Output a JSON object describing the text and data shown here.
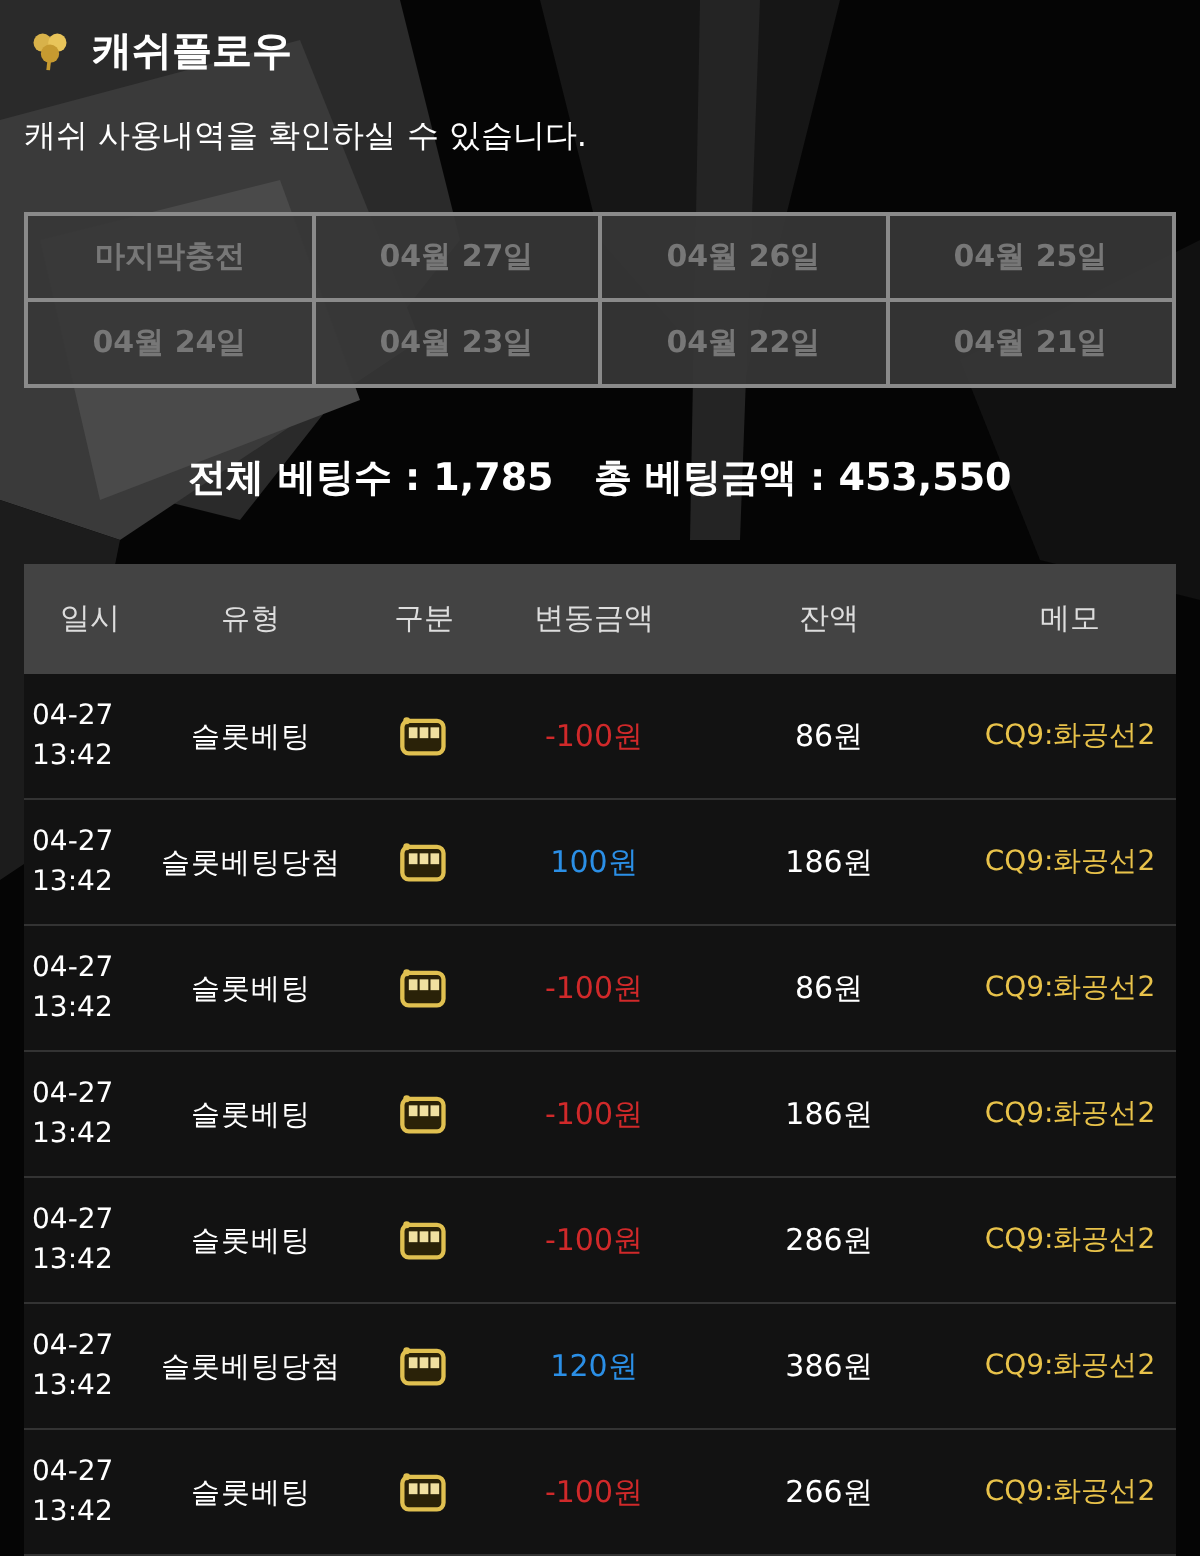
{
  "header": {
    "title": "캐쉬플로우",
    "subtitle": "캐쉬 사용내역을 확인하실 수 있습니다."
  },
  "date_buttons": [
    "마지막충전",
    "04월 27일",
    "04월 26일",
    "04월 25일",
    "04월 24일",
    "04월 23일",
    "04월 22일",
    "04월 21일"
  ],
  "totals": {
    "bet_count_label": "전체 베팅수 : 1,785",
    "bet_amount_label": "총 베팅금액 : 453,550"
  },
  "table": {
    "columns": [
      "일시",
      "유형",
      "구분",
      "변동금액",
      "잔액",
      "메모"
    ],
    "rows": [
      {
        "kind": "bet",
        "date": "04-27",
        "time": "13:42",
        "type": "슬롯베팅",
        "amount": "-100원",
        "balance": "86원",
        "memo": "CQ9:화공선2"
      },
      {
        "kind": "win",
        "date": "04-27",
        "time": "13:42",
        "type": "슬롯베팅당첨",
        "amount": "100원",
        "balance": "186원",
        "memo": "CQ9:화공선2"
      },
      {
        "kind": "bet",
        "date": "04-27",
        "time": "13:42",
        "type": "슬롯베팅",
        "amount": "-100원",
        "balance": "86원",
        "memo": "CQ9:화공선2"
      },
      {
        "kind": "bet",
        "date": "04-27",
        "time": "13:42",
        "type": "슬롯베팅",
        "amount": "-100원",
        "balance": "186원",
        "memo": "CQ9:화공선2"
      },
      {
        "kind": "bet",
        "date": "04-27",
        "time": "13:42",
        "type": "슬롯베팅",
        "amount": "-100원",
        "balance": "286원",
        "memo": "CQ9:화공선2"
      },
      {
        "kind": "win",
        "date": "04-27",
        "time": "13:42",
        "type": "슬롯베팅당첨",
        "amount": "120원",
        "balance": "386원",
        "memo": "CQ9:화공선2"
      },
      {
        "kind": "bet",
        "date": "04-27",
        "time": "13:42",
        "type": "슬롯베팅",
        "amount": "-100원",
        "balance": "266원",
        "memo": "CQ9:화공선2"
      }
    ]
  }
}
